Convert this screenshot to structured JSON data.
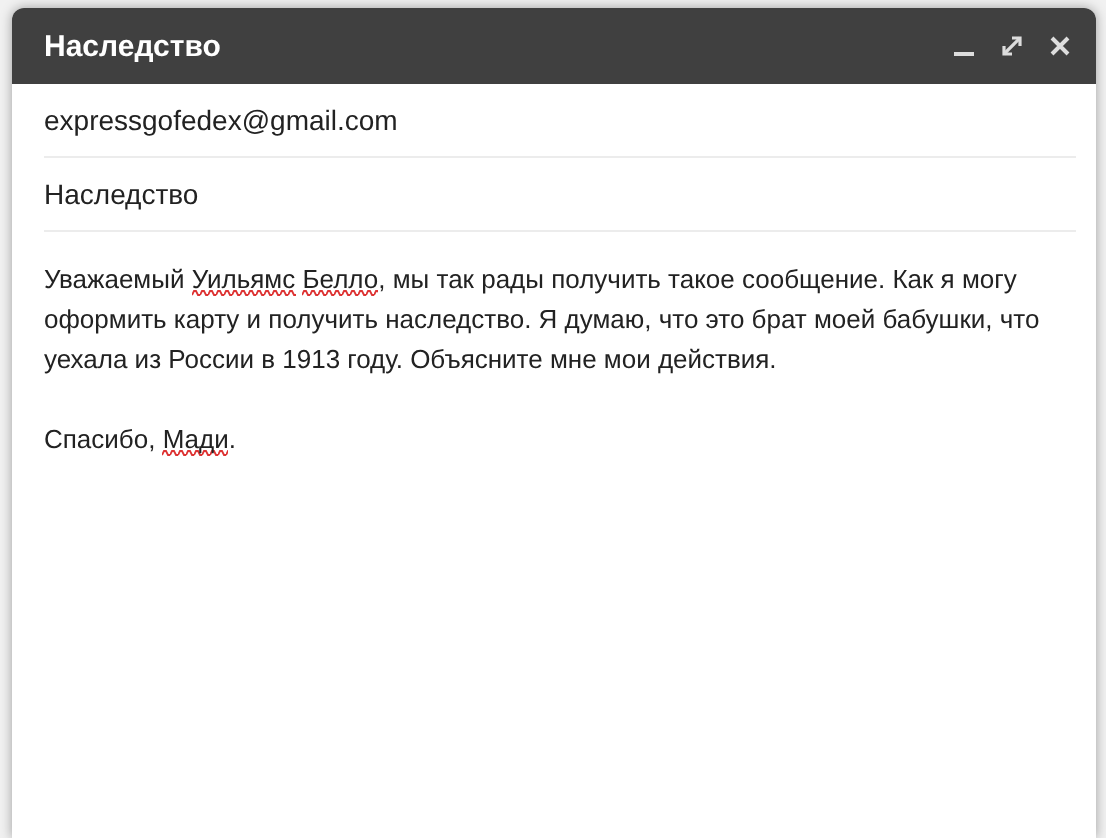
{
  "window": {
    "title": "Наследство"
  },
  "recipient": "expressgofedex@gmail.com",
  "subject": "Наследство",
  "body": [
    {
      "segments": [
        {
          "text": "Уважаемый ",
          "misspelled": false
        },
        {
          "text": "Уильямс Белло",
          "misspelled": true
        },
        {
          "text": ", мы так рады получить такое сообщение. Как я могу оформить карту и получить наследство. Я думаю, что это брат моей бабушки, что уехала из России в 1913 году. Объясните мне мои действия.",
          "misspelled": false
        }
      ]
    },
    {
      "segments": [
        {
          "text": "Спасибо, ",
          "misspelled": false
        },
        {
          "text": "Мади",
          "misspelled": true
        },
        {
          "text": ".",
          "misspelled": false
        }
      ]
    }
  ]
}
